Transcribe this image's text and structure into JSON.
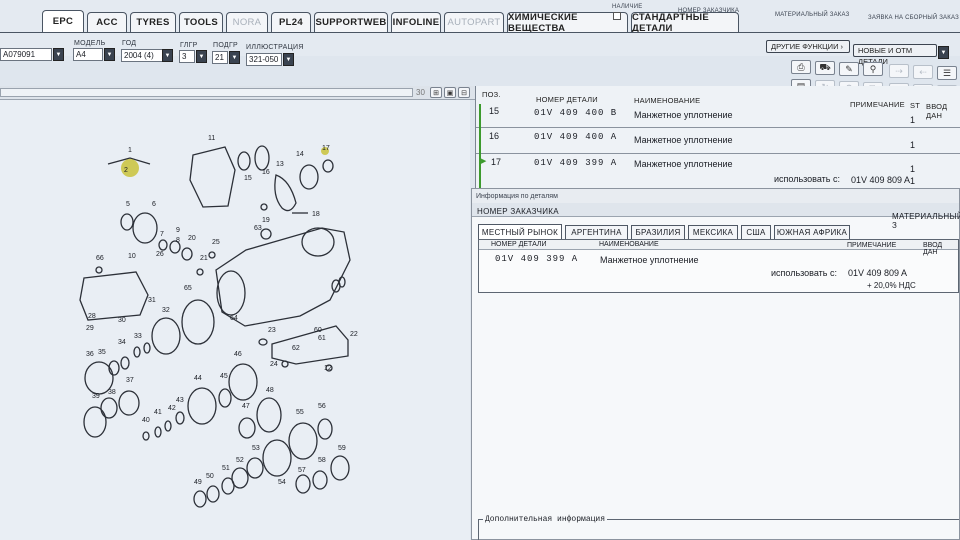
{
  "tabs": [
    {
      "label": "EPC",
      "active": true
    },
    {
      "label": "ACC"
    },
    {
      "label": "TYRES"
    },
    {
      "label": "TOOLS"
    },
    {
      "label": "NORA",
      "disabled": true
    },
    {
      "label": "PL24"
    },
    {
      "label": "SUPPORTWEB"
    },
    {
      "label": "INFOLINE"
    },
    {
      "label": "AUTOPART",
      "disabled": true
    },
    {
      "label": "ХИМИЧЕСКИЕ ВЕЩЕСТВА"
    },
    {
      "label": "СТАНДАРТНЫЕ ДЕТАЛИ"
    }
  ],
  "top_right": {
    "availability_label": "НАЛИЧИЕ",
    "customer_number_label": "НОМЕР ЗАКАЗЧИКА",
    "material_order_label": "МАТЕРИАЛЬНЫЙ ЗАКАЗ",
    "assembly_request_label": "ЗАЯВКА НА СБОРНЫЙ ЗАКАЗ"
  },
  "selectors": {
    "vin_value": "A079091",
    "model_label": "МОДЕЛЬ",
    "model_value": "A4",
    "year_label": "ГОД",
    "year_value": "2004 (4)",
    "mg_label": "ГЛГР",
    "mg_value": "3",
    "sg_label": "ПОДГР",
    "sg_value": "21",
    "illustration_label": "ИЛЛЮСТРАЦИЯ",
    "illustration_value": "321-050"
  },
  "buttons": {
    "other_functions": "ДРУГИЕ ФУНКЦИИ ›",
    "new_parts": "НОВЫЕ И ОТМ ДЕТАЛИ"
  },
  "zoom": {
    "value": "30"
  },
  "parts_table": {
    "headers": {
      "pos": "ПОЗ.",
      "part_no": "НОМЕР ДЕТАЛИ",
      "name": "НАИМЕНОВАНИЕ",
      "note": "ПРИМЕЧАНИЕ",
      "st": "ST",
      "qty": "ВВОД ДАН"
    },
    "rows": [
      {
        "pos": "15",
        "part_no": "01V  409  400  B",
        "name": "Манжетное уплотнение",
        "qty": "1"
      },
      {
        "pos": "16",
        "part_no": "01V  409  400  A",
        "name": "Манжетное уплотнение",
        "qty": "1"
      },
      {
        "pos": "17",
        "part_no": "01V  409  399  A",
        "name": "Манжетное уплотнение",
        "qty": "1",
        "use_from_label": "использовать с:",
        "use_from_value": "01V 409 809 A",
        "use_qty": "1"
      }
    ]
  },
  "dialog": {
    "title": "Информация по деталям",
    "customer_number_label": "НОМЕР ЗАКАЗЧИКА",
    "material_label": "МАТЕРИАЛЬНЫЙ З",
    "tabs": [
      "МЕСТНЫЙ РЫНОК",
      "АРГЕНТИНА",
      "БРАЗИЛИЯ",
      "МЕКСИКА",
      "США",
      "ЮЖНАЯ АФРИКА"
    ],
    "headers": {
      "part_no": "НОМЕР ДЕТАЛИ",
      "name": "НАИМЕНОВАНИЕ",
      "note": "ПРИМЕЧАНИЕ",
      "qty": "ВВОД ДАН"
    },
    "row": {
      "part_no": "01V  409  399  A",
      "name": "Манжетное уплотнение",
      "use_from_label": "использовать с:",
      "use_from_value": "01V 409 809 A",
      "vat": "+ 20,0% НДС"
    },
    "additional_info_label": "Дополнительная информация"
  },
  "diagram_labels": [
    "1",
    "2",
    "6",
    "11",
    "14",
    "15",
    "16",
    "13",
    "17",
    "19",
    "18",
    "5",
    "7",
    "8",
    "9",
    "10",
    "12",
    "20",
    "21",
    "22",
    "23",
    "24",
    "25",
    "26",
    "28",
    "29",
    "30",
    "31",
    "32",
    "33",
    "34",
    "35",
    "36",
    "37",
    "38",
    "39",
    "40",
    "41",
    "42",
    "43",
    "44",
    "45",
    "46",
    "47",
    "48",
    "49",
    "50",
    "51",
    "52",
    "53",
    "54",
    "55",
    "56",
    "57",
    "58",
    "59",
    "60",
    "61",
    "62",
    "63",
    "64",
    "65",
    "66"
  ]
}
